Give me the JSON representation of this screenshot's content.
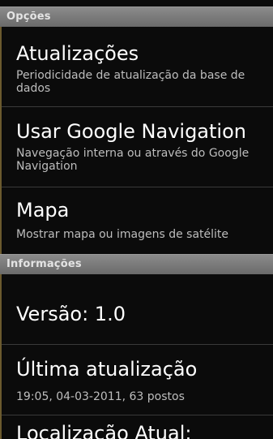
{
  "sections": [
    {
      "header": "Opções"
    },
    {
      "header": "Informações"
    }
  ],
  "options": {
    "updates": {
      "title": "Atualizações",
      "summary": "Periodicidade de atualização da base de dados"
    },
    "google_nav": {
      "title": "Usar Google Navigation",
      "summary": "Navegação interna ou através do Google Navigation"
    },
    "map": {
      "title": "Mapa",
      "summary": "Mostrar mapa ou imagens de satélite"
    }
  },
  "info": {
    "version": {
      "title": "Versão: 1.0"
    },
    "last_update": {
      "title": "Última atualização",
      "summary": "19:05, 04-03-2011, 63 postos"
    },
    "current_location": {
      "title": "Localização Atual:"
    }
  }
}
